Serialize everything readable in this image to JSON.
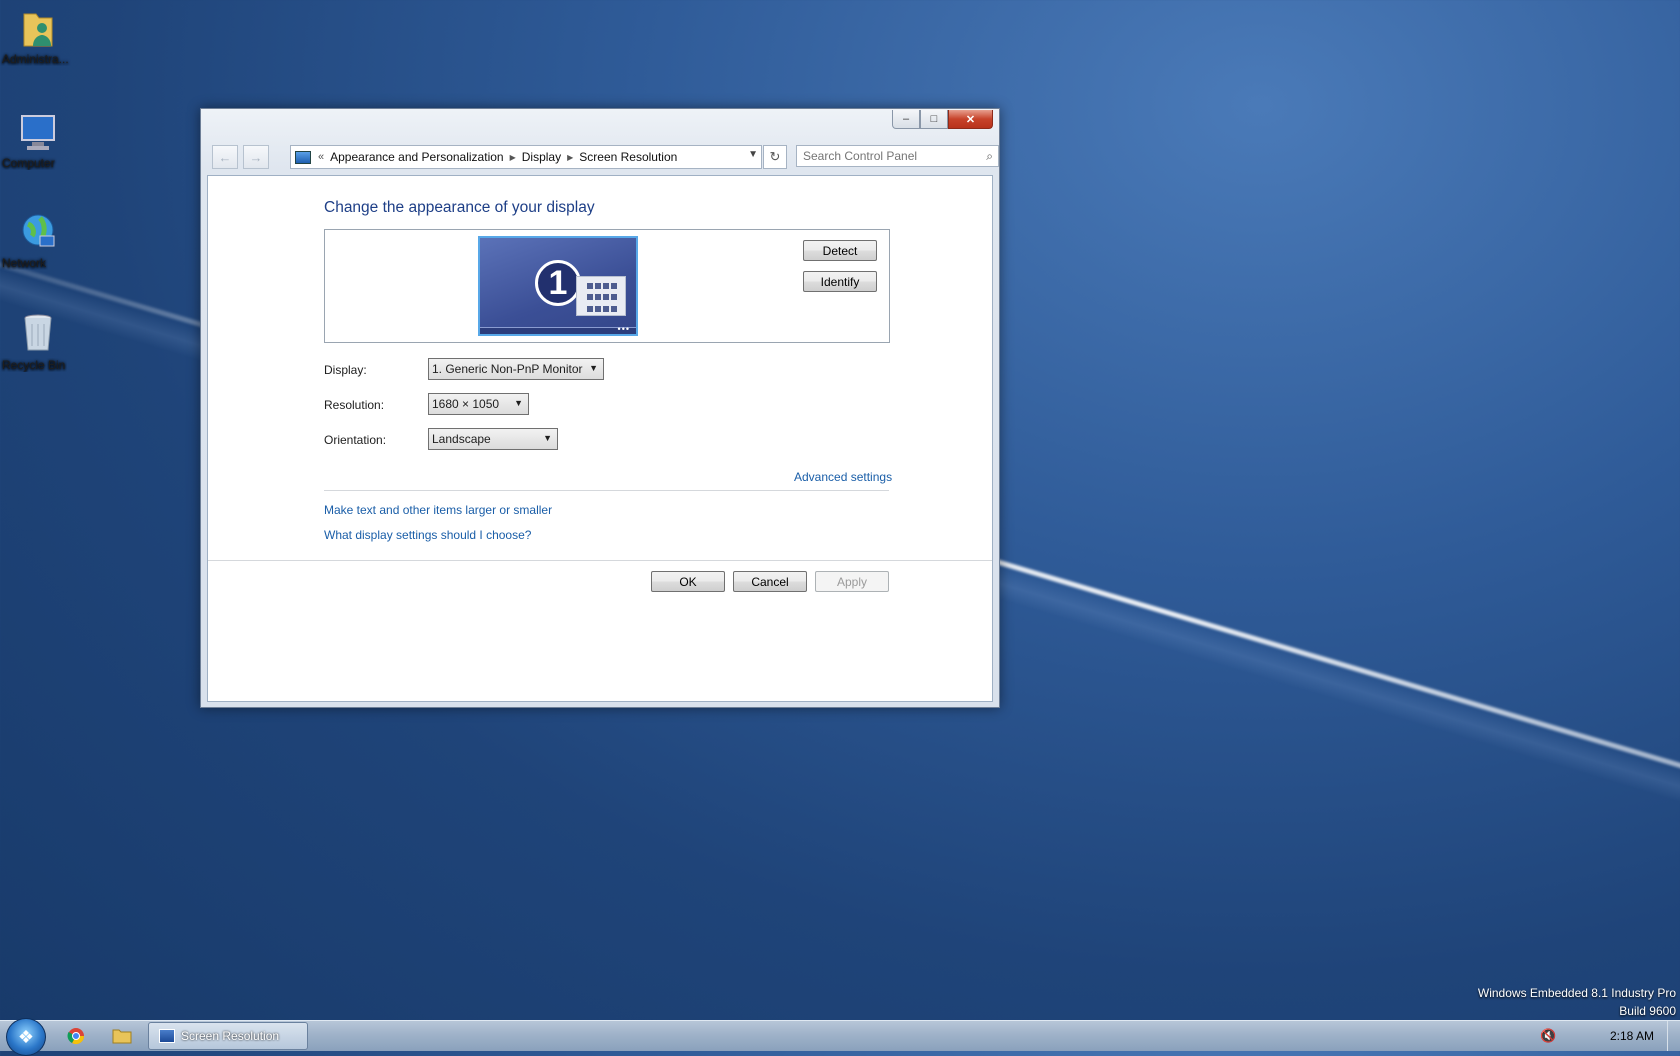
{
  "desktop": {
    "icons": [
      {
        "label": "Administra..."
      },
      {
        "label": "Computer"
      },
      {
        "label": "Network"
      },
      {
        "label": "Recycle Bin"
      }
    ],
    "watermark": {
      "line1": "Windows Embedded 8.1 Industry Pro",
      "line2": "Build 9600"
    }
  },
  "window": {
    "caption": {
      "minimize": "–",
      "maximize": "□",
      "close": "✕"
    },
    "nav": {
      "back": "←",
      "forward": "→"
    },
    "address": {
      "chevrons": "«",
      "crumbs": [
        "Appearance and Personalization",
        "Display",
        "Screen Resolution"
      ]
    },
    "search": {
      "placeholder": "Search Control Panel"
    },
    "heading": "Change the appearance of your display",
    "monitor_number": "1",
    "buttons": {
      "detect": "Detect",
      "identify": "Identify"
    },
    "fields": {
      "display": {
        "label": "Display:",
        "value": "1. Generic Non-PnP Monitor"
      },
      "resolution": {
        "label": "Resolution:",
        "value": "1680 × 1050"
      },
      "orientation": {
        "label": "Orientation:",
        "value": "Landscape"
      }
    },
    "links": {
      "advanced": "Advanced settings",
      "text_size": "Make text and other items larger or smaller",
      "help": "What display settings should I choose?"
    },
    "footer": {
      "ok": "OK",
      "cancel": "Cancel",
      "apply": "Apply"
    }
  },
  "taskbar": {
    "task_label": "Screen Resolution",
    "clock": "2:18 AM"
  },
  "colors": {
    "accent_link": "#1a5ea8",
    "heading": "#1e3f87",
    "close_button": "#c7432a"
  }
}
